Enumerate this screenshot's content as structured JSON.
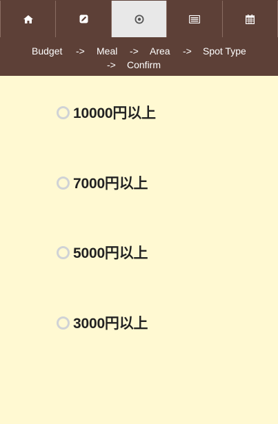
{
  "tabs": [
    {
      "icon": "home-icon",
      "active": false
    },
    {
      "icon": "edit-icon",
      "active": false
    },
    {
      "icon": "target-icon",
      "active": true
    },
    {
      "icon": "list-icon",
      "active": false
    },
    {
      "icon": "calendar-icon",
      "active": false
    }
  ],
  "breadcrumb": {
    "budget": "Budget",
    "arrow1": "->",
    "meal": "Meal",
    "arrow2": "->",
    "area": "Area",
    "arrow3": "->",
    "spot_type": "Spot Type",
    "arrow4": "->",
    "confirm": "Confirm"
  },
  "options": [
    {
      "label": "10000円以上"
    },
    {
      "label": "7000円以上"
    },
    {
      "label": "5000円以上"
    },
    {
      "label": "3000円以上"
    }
  ],
  "colors": {
    "header_bg": "#5d4037",
    "page_bg": "#fff9d2",
    "active_tab_bg": "#e8e8e8",
    "radio_border": "#d0d3d6"
  }
}
